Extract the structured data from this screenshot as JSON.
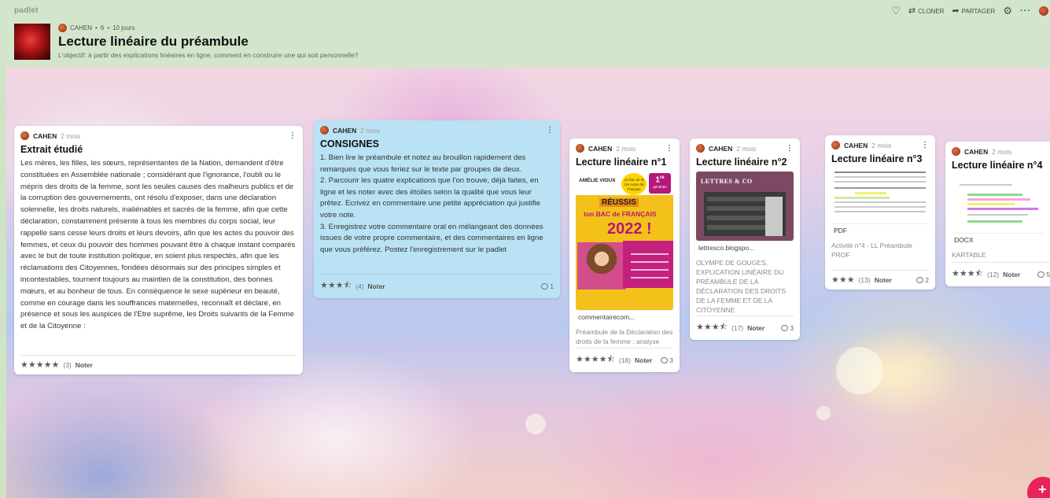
{
  "app": {
    "brand": "padlet"
  },
  "header_actions": {
    "heart": "heart-icon",
    "clone_label": "CLONER",
    "share_label": "PARTAGER",
    "settings": "gear-icon",
    "more": "more-icon"
  },
  "board": {
    "author": "CAHEN",
    "likes": "6",
    "age": "10 jours",
    "title": "Lecture linéaire du préambule",
    "description": "L'objectif: à partir des explications linéaires en ligne, comment en construire une qui soit personnelle?"
  },
  "posts": [
    {
      "author": "CAHEN",
      "time": "2 mois",
      "title": "Extrait étudié",
      "body": " Les mères, les filles, les sœurs, représentantes de la Nation, demandent d'être constituées en Assemblée nationale ; considérant que l'ignorance, l'oubli ou le mépris des droits de la femme, sont les seules causes des malheurs publics et de la corruption des gouvernements, ont résolu d'exposer, dans une déclaration solennelle, les droits naturels, inaliénables et sacrés de la femme, afin que cette déclaration, constamment présente à tous les membres du corps social, leur rappelle sans cesse leurs droits et leurs devoirs, afin que les actes du pouvoir des femmes, et ceux du pouvoir des hommes pouvant être à chaque instant comparés avec le but de toute institution politique, en soient plus respectés, afin que les réclamations des Citoyennes, fondées désormais sur des principes simples et incontestables, tournent toujours au maintien de la constitution, des bonnes mœurs, et au bonheur de tous. En conséquence le sexe supérieur en beauté, comme en courage dans les souffrances maternelles, reconnaît et déclare, en présence et sous les auspices de l'Etre suprême, les Droits suivants de la Femme et de la Citoyenne :",
      "stars": "★★★★★",
      "rating_count": "(3)",
      "rate_label": "Noter",
      "comments": ""
    },
    {
      "author": "CAHEN",
      "time": "2 mois",
      "title": "CONSIGNES",
      "body": "1. Bien lire le préambule et notez au brouillon rapidement des remarques que vous feriez sur le texte par groupes de deux.\n2. Parcourir les quatre explications que l'on trouve, déjà faites, en ligne et les noter avec des étoiles selon la qualité que vous leur prêtez. Ecrivez en commentaire une petite appréciation qui justifie votre note.\n3. Enregistrez votre commentaire oral en mélangeant des données issues de votre propre commentaire, et des commentaires en ligne que vous préférez. Postez l'enregistrement sur le padlet",
      "stars": "★★★⯪",
      "rating_count": "(4)",
      "rate_label": "Noter",
      "comments": "1"
    },
    {
      "author": "CAHEN",
      "time": "2 mois",
      "title": "Lecture linéaire n°1",
      "cover": {
        "author_name": "AMÉLIE VIOUX",
        "sticker": "Le bac de la 1re Actes de Français",
        "badge_big": "1",
        "badge_sup": "re",
        "badge_small": "générale",
        "reussis": "RÉUSSIS",
        "bac": "ton BAC de FRANÇAIS",
        "year": "2022 !"
      },
      "link_label": "commentairecom...",
      "description": "Préambule de la Déclaration des droits de la femme : analyse",
      "stars": "★★★★⯪",
      "rating_count": "(18)",
      "rate_label": "Noter",
      "comments": "3"
    },
    {
      "author": "CAHEN",
      "time": "2 mois",
      "title": "Lecture linéaire n°2",
      "cover": {
        "heading": "LETTRES & CO"
      },
      "link_label": "lettresco.blogspo...",
      "description": "OLYMPE DE GOUGES, EXPLICATION LINÉAIRE DU PRÉAMBULE DE LA DÉCLARATION DES DROITS DE LA FEMME ET DE LA CITOYENNE",
      "stars": "★★★⯪",
      "rating_count": "(17)",
      "rate_label": "Noter",
      "comments": "3"
    },
    {
      "author": "CAHEN",
      "time": "2 mois",
      "title": "Lecture linéaire n°3",
      "file_type": "PDF",
      "description": "Activité n°4 - LL Préambule PROF",
      "stars": "★★★",
      "rating_count": "(13)",
      "rate_label": "Noter",
      "comments": "2"
    },
    {
      "author": "CAHEN",
      "time": "2 mois",
      "title": "Lecture linéaire n°4",
      "file_type": "DOCX",
      "description": "KARTABLE",
      "stars": "★★★⯪",
      "rating_count": "(12)",
      "rate_label": "Noter",
      "comments": "5"
    }
  ],
  "colors": {
    "header_bg": "#d3e6cc",
    "consignes_bg": "#b9e3f5",
    "add_button": "#e8245a"
  },
  "icons": {
    "author_avatar": "avatar",
    "comment": "comment-bubble-icon",
    "add": "plus-icon"
  },
  "add_button": "+"
}
